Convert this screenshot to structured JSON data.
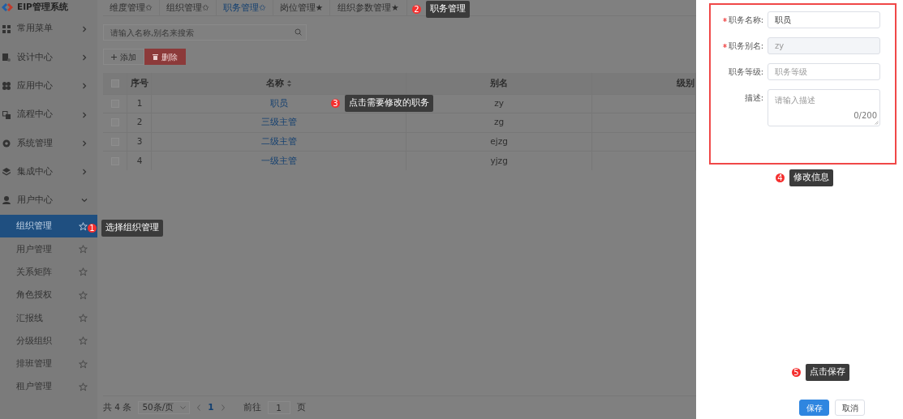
{
  "app": {
    "title": "EIP管理系统"
  },
  "sidebar": {
    "menus": [
      {
        "label": "常用菜单",
        "expanded": false
      },
      {
        "label": "设计中心",
        "expanded": false
      },
      {
        "label": "应用中心",
        "expanded": false
      },
      {
        "label": "流程中心",
        "expanded": false
      },
      {
        "label": "系统管理",
        "expanded": false
      },
      {
        "label": "集成中心",
        "expanded": false
      },
      {
        "label": "用户中心",
        "expanded": true,
        "children": [
          {
            "label": "组织管理",
            "selected": true
          },
          {
            "label": "用户管理",
            "selected": false
          },
          {
            "label": "关系矩阵",
            "selected": false
          },
          {
            "label": "角色授权",
            "selected": false
          },
          {
            "label": "汇报线",
            "selected": false
          },
          {
            "label": "分级组织",
            "selected": false
          },
          {
            "label": "排班管理",
            "selected": false
          },
          {
            "label": "租户管理",
            "selected": false
          }
        ]
      }
    ]
  },
  "tabs": [
    {
      "label": "维度管理✩",
      "selected": false
    },
    {
      "label": "组织管理✩",
      "selected": false
    },
    {
      "label": "职务管理✩",
      "selected": true
    },
    {
      "label": "岗位管理★",
      "selected": false
    },
    {
      "label": "组织参数管理★",
      "selected": false
    }
  ],
  "search": {
    "placeholder": "请输入名称,别名来搜索"
  },
  "toolbar": [
    {
      "label": "添加",
      "kind": "add"
    },
    {
      "label": "删除",
      "kind": "delete"
    }
  ],
  "table": {
    "select_all_checked": false,
    "columns": [
      "序号",
      "名称",
      "别名",
      "级别"
    ],
    "rows": [
      {
        "index": "1",
        "name": "职员",
        "alias": "zy",
        "checked": false
      },
      {
        "index": "2",
        "name": "三级主管",
        "alias": "zg",
        "checked": false
      },
      {
        "index": "3",
        "name": "二级主管",
        "alias": "ejzg",
        "checked": false
      },
      {
        "index": "4",
        "name": "一级主管",
        "alias": "yjzg",
        "checked": false
      }
    ]
  },
  "pagination": {
    "total": "共 4 条",
    "page_size": "50条/页",
    "current": "1",
    "goto_label": "前往",
    "goto_value": "1",
    "page_suffix": "页"
  },
  "drawer": {
    "fields": [
      {
        "label": "职务名称:",
        "required": true,
        "kind": "input",
        "value": "职员",
        "disabled": false
      },
      {
        "label": "职务别名:",
        "required": true,
        "kind": "input",
        "value": "zy",
        "disabled": true
      },
      {
        "label": "职务等级:",
        "required": false,
        "kind": "input",
        "placeholder": "职务等级",
        "disabled": false
      },
      {
        "label": "描述:",
        "required": false,
        "kind": "textarea",
        "placeholder": "请输入描述",
        "counter": "0/200",
        "disabled": false
      }
    ],
    "buttons": [
      {
        "label": "保存",
        "kind": "primary"
      },
      {
        "label": "取消",
        "kind": "default"
      }
    ]
  },
  "callouts": [
    {
      "number": "1",
      "text": "选择组织管理"
    },
    {
      "number": "2",
      "text": "职务管理"
    },
    {
      "number": "3",
      "text": "点击需要修改的职务"
    },
    {
      "number": "4",
      "text": "修改信息"
    },
    {
      "number": "5",
      "text": "点击保存"
    }
  ]
}
